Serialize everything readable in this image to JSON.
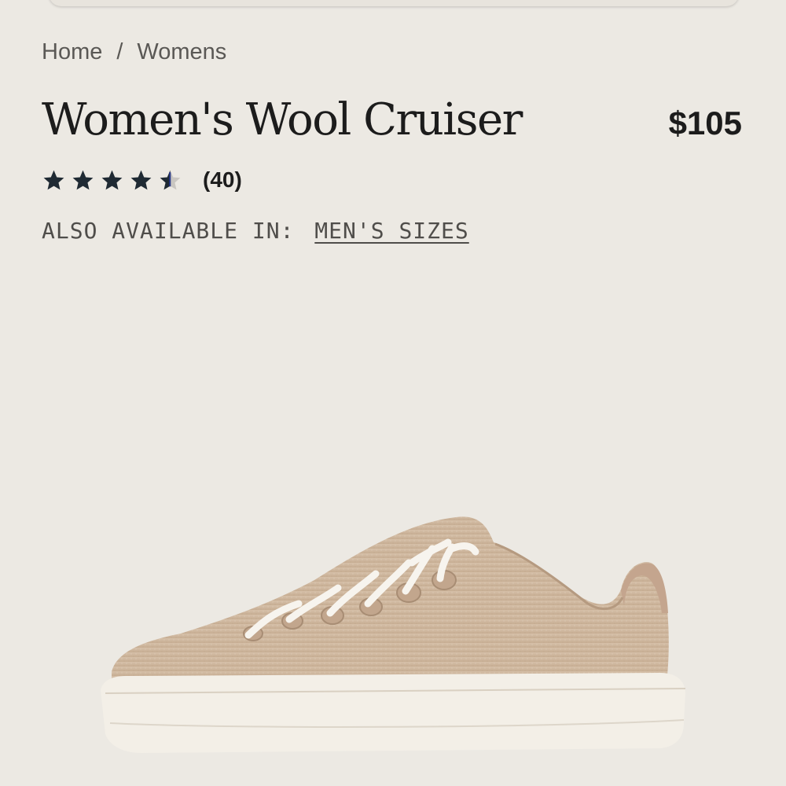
{
  "breadcrumb": {
    "home": "Home",
    "separator": "/",
    "current": "Womens"
  },
  "product": {
    "title": "Women's Wool Cruiser",
    "price": "$105",
    "rating": 4.5,
    "rating_max": 5,
    "review_count": "(40)",
    "also_label": "ALSO AVAILABLE IN:",
    "also_link": "MEN'S SIZES",
    "image_icon": "wool-sneaker"
  },
  "colors": {
    "background": "#ece9e3",
    "text": "#1c1c1c",
    "star": "#1f2a33",
    "star_half_accent": "#2a3a8a",
    "shoe_wool": "#cfb8a0",
    "sole": "#f2eee6"
  }
}
